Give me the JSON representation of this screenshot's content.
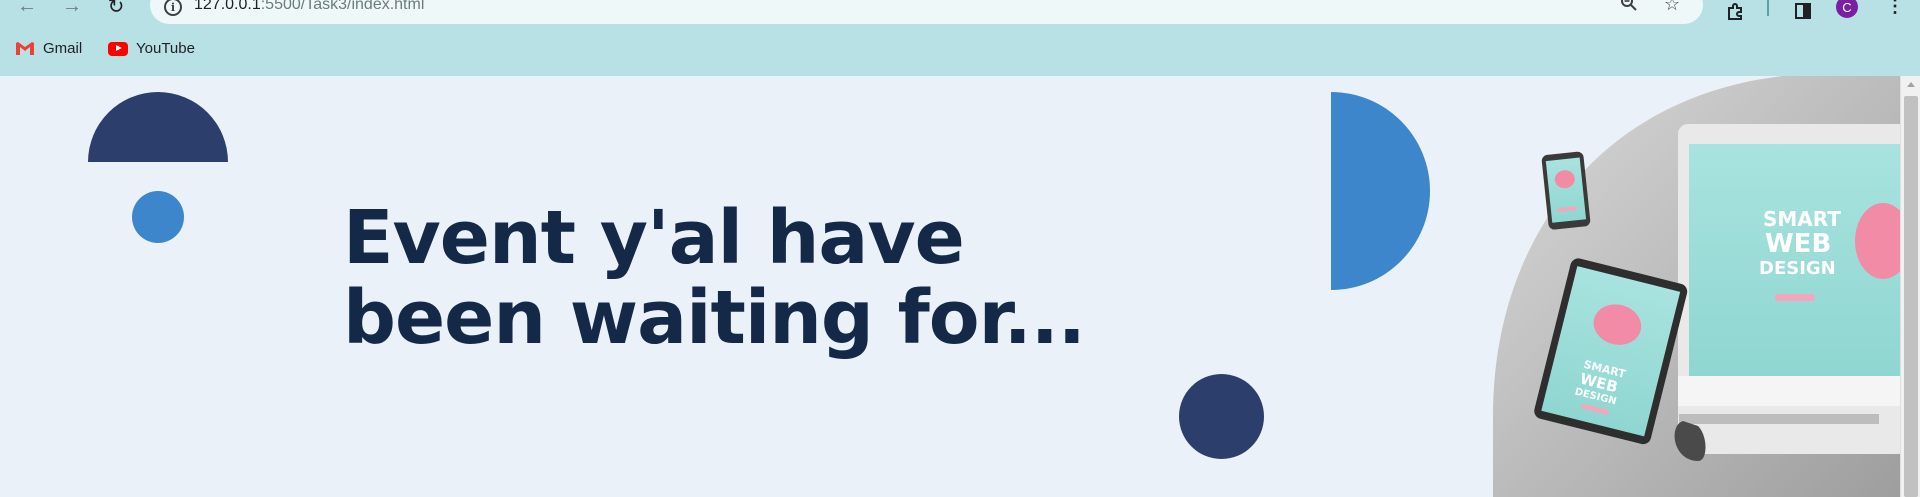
{
  "browser": {
    "url_host": "127.0.0.1",
    "url_rest": ":5500/Task3/index.html",
    "avatar_letter": "C",
    "bookmarks": [
      {
        "label": "Gmail",
        "icon": "gmail-icon"
      },
      {
        "label": "YouTube",
        "icon": "youtube-icon"
      }
    ]
  },
  "hero": {
    "headline_line1": "Event y'al have",
    "headline_line2": "been waiting for...",
    "image_text_smart": "SMART",
    "image_text_web": "WEB",
    "image_text_design": "DESIGN"
  },
  "colors": {
    "chrome_bg": "#b8e1e5",
    "page_bg": "#eaf1f8",
    "navy": "#2c3e6b",
    "blue": "#3d86cc",
    "headline": "#142847"
  }
}
